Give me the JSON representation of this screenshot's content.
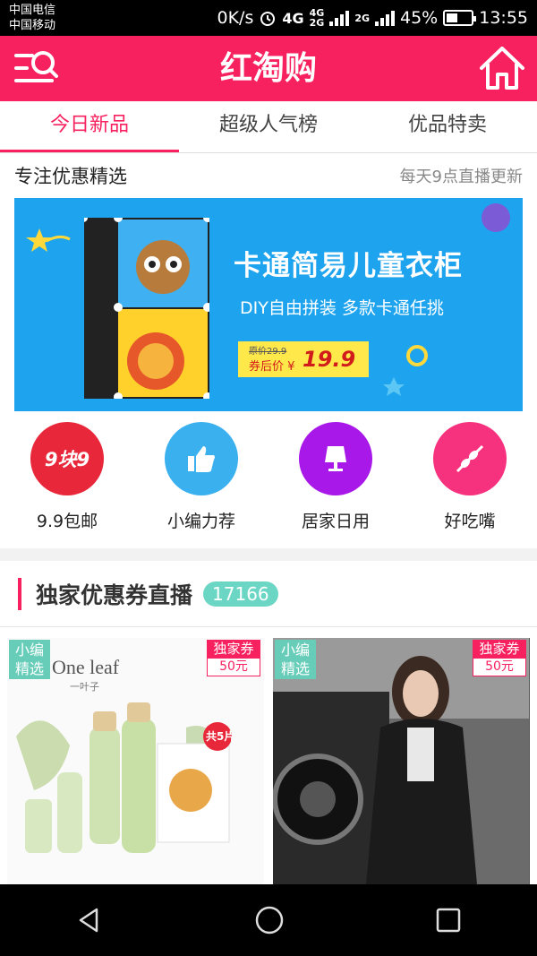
{
  "status_bar": {
    "carrier1": "中国电信",
    "carrier2": "中国移动",
    "speed": "0K/s",
    "net1": "4G",
    "net2": "4G",
    "net2b": "2G",
    "net3": "2G",
    "battery": "45%",
    "battery_level": 0.45,
    "time": "13:55"
  },
  "header": {
    "title": "红淘购"
  },
  "tabs": [
    {
      "label": "今日新品",
      "active": true
    },
    {
      "label": "超级人气榜",
      "active": false
    },
    {
      "label": "优品特卖",
      "active": false
    }
  ],
  "featured": {
    "title": "专注优惠精选",
    "subtitle": "每天9点直播更新",
    "banner": {
      "title": "卡通简易儿童衣柜",
      "subtitle": "DIY自由拼装 多款卡通任挑",
      "orig_price": "原价29.9",
      "after_label": "券后价 ¥",
      "price": "19.9"
    }
  },
  "categories": [
    {
      "label": "9.9包邮",
      "icon_text": "9块9",
      "color": "#e8283a",
      "icon": "nine-nine-icon"
    },
    {
      "label": "小编力荐",
      "color": "#3bb0ef",
      "icon": "thumbs-up-icon"
    },
    {
      "label": "居家日用",
      "color": "#a818e8",
      "icon": "lamp-icon"
    },
    {
      "label": "好吃嘴",
      "color": "#f6317d",
      "icon": "kebab-icon"
    }
  ],
  "coupons": {
    "title": "独家优惠券直播",
    "count": "17166",
    "products": [
      {
        "pick_tag": "小编精选",
        "coupon_tag": "独家券",
        "coupon_value": "50元",
        "brand_text": "One leaf",
        "brand_cn": "一叶子",
        "promo": "共5片"
      },
      {
        "pick_tag": "小编精选",
        "coupon_tag": "独家券",
        "coupon_value": "50元"
      }
    ]
  },
  "colors": {
    "brand": "#f7215f",
    "accent_teal": "#67cdb8"
  }
}
